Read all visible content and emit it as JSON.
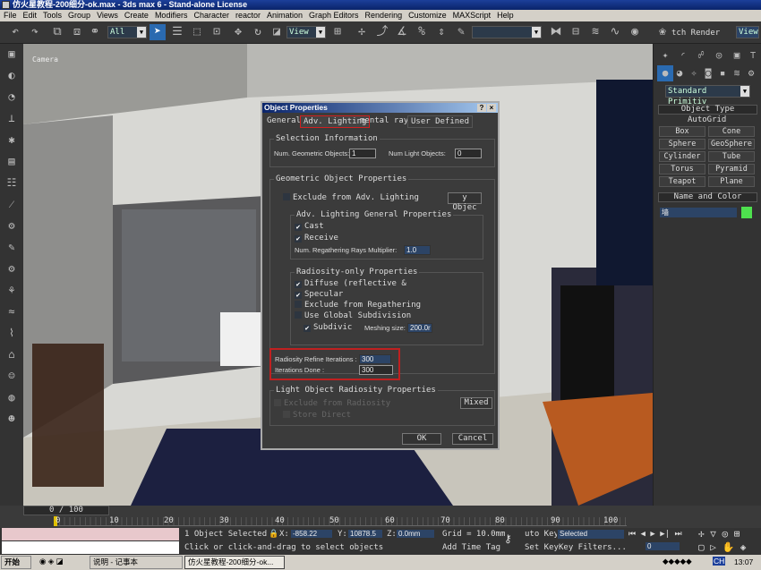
{
  "window": {
    "title": "仿火星教程-200细分-ok.max - 3ds max 6 - Stand-alone License"
  },
  "menu": [
    "File",
    "Edit",
    "Tools",
    "Group",
    "Views",
    "Create",
    "Modifiers",
    "Character",
    "reactor",
    "Animation",
    "Graph Editors",
    "Rendering",
    "Customize",
    "MAXScript",
    "Help"
  ],
  "toolbar": {
    "selection_filter": "All",
    "ref_coord": "View",
    "render_label": "tch Render",
    "render_view": "View"
  },
  "viewport": {
    "label": "Camera"
  },
  "dialog": {
    "title": "Object Properties",
    "help": "?",
    "close": "×",
    "tabs": [
      "General",
      "Adv. Lighting",
      "mental ray",
      "User Defined"
    ],
    "active_tab": "Adv. Lighting",
    "selection_info": {
      "title": "Selection Information",
      "geo_label": "Num. Geometric Objects:",
      "geo_value": "1",
      "light_label": "Num Light Objects:",
      "light_value": "0"
    },
    "geo_props": {
      "title": "Geometric Object Properties",
      "exclude": "Exclude from Adv. Lighting",
      "by_object": "y Objec",
      "general": {
        "title": "Adv. Lighting General Properties",
        "cast": "Cast",
        "receive": "Receive",
        "rays_label": "Num. Regathering Rays Multiplier:",
        "rays_value": "1.0"
      },
      "radiosity": {
        "title": "Radiosity-only Properties",
        "diffuse": "Diffuse (reflective &",
        "specular": "Specular",
        "exclude_regather": "Exclude from Regathering",
        "global_subdiv": "Use Global Subdivision",
        "subdivide": "Subdivic",
        "meshing_label": "Meshing size:",
        "meshing_value": "200.0r"
      },
      "refine_label": "Radiosity Refine Iterations :",
      "refine_value": "300",
      "done_label": "Iterations Done :",
      "done_value": "300"
    },
    "light_props": {
      "title": "Light Object Radiosity Properties",
      "exclude": "Exclude from Radiosity",
      "store_direct": "Store Direct",
      "mixed": "Mixed"
    },
    "ok": "OK",
    "cancel": "Cancel"
  },
  "panel": {
    "dropdown": "Standard Primitiv",
    "object_type": "Object Type",
    "autogrid": "AutoGrid",
    "buttons": [
      "Box",
      "Cone",
      "Sphere",
      "GeoSphere",
      "Cylinder",
      "Tube",
      "Torus",
      "Pyramid",
      "Teapot",
      "Plane"
    ],
    "name_color": "Name and Color",
    "name_value": "墙",
    "color": "#4ee04e"
  },
  "timeline": {
    "frame": "0 / 100",
    "ticks": [
      "0",
      "10",
      "20",
      "30",
      "40",
      "50",
      "60",
      "70",
      "80",
      "90",
      "100"
    ]
  },
  "status": {
    "selected": "1 Object Selected",
    "x": "-858.22",
    "y": "10878.5",
    "z": "0.0mm",
    "grid": "Grid = 10.0mm",
    "auto_key": "uto Key",
    "key_mode": "Selected",
    "set_key": "Set Key",
    "key_filters": "Key Filters...",
    "prompt": "Click or click-and-drag to select objects",
    "add_time_tag": "Add Time Tag",
    "frame_value": "0"
  },
  "taskbar": {
    "start": "开始",
    "tasks": [
      "说明 - 记事本",
      "仿火星教程-200细分-ok..."
    ],
    "clock": "13:07",
    "ime": "CH"
  }
}
